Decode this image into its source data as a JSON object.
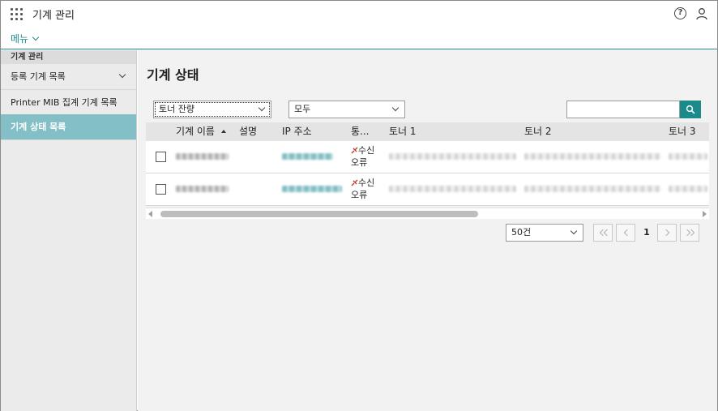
{
  "app": {
    "title": "기계 관리",
    "menu_label": "메뉴"
  },
  "sidebar": {
    "header": "기계 관리",
    "items": [
      {
        "label": "등록 기계 목록"
      },
      {
        "label": "Printer MIB 집계 기계 목록"
      },
      {
        "label": "기계 상태 목록"
      }
    ]
  },
  "main": {
    "title": "기계 상태",
    "filter_type_value": "토너 잔량",
    "filter_scope_value": "모두",
    "search_value": "",
    "columns": {
      "name": "기계 이름",
      "description": "설명",
      "ip": "IP 주소",
      "status": "통...",
      "toner1": "토너 1",
      "toner2": "토너 2",
      "toner3": "토너 3"
    },
    "rows": [
      {
        "status_line1": "수신",
        "status_line2": "오류"
      },
      {
        "status_line1": "수신",
        "status_line2": "오류"
      }
    ],
    "page_size_value": "50건",
    "current_page": "1"
  },
  "colors": {
    "accent": "#1a8a8a",
    "sidebar_active": "#82bfc6",
    "status_icon": "#c0392b"
  },
  "icons": {
    "apps": "apps-grid-icon",
    "help": "help-icon",
    "user": "user-icon",
    "search": "search-icon",
    "status": "disconnected-icon"
  }
}
